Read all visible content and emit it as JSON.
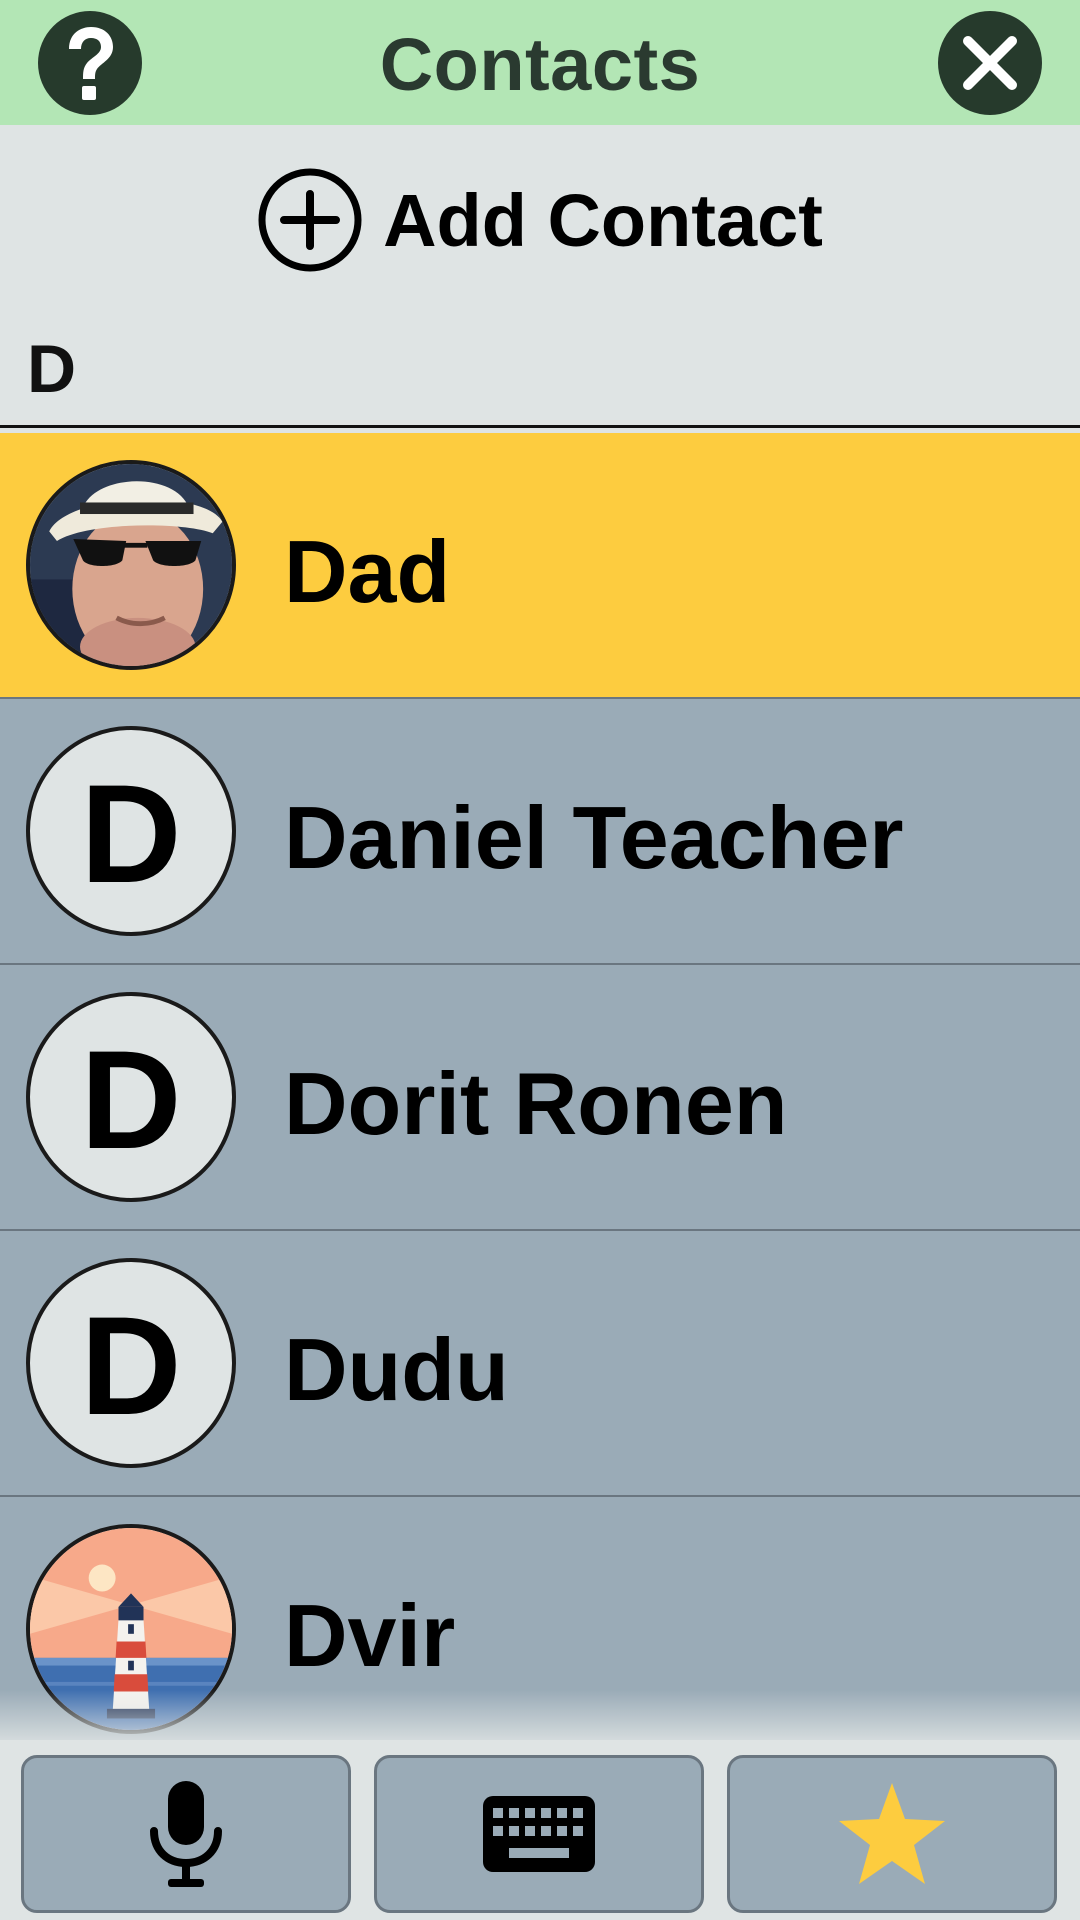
{
  "header": {
    "title": "Contacts",
    "help_icon": "help-question-icon",
    "close_icon": "close-x-icon",
    "color": "#b3e6b5"
  },
  "add_contact": {
    "label": "Add Contact",
    "icon": "plus-circle-icon"
  },
  "section": {
    "letter": "D"
  },
  "contacts": [
    {
      "name": "Dad",
      "avatar_type": "photo",
      "avatar_letter": "",
      "selected": true
    },
    {
      "name": "Daniel Teacher",
      "avatar_type": "letter",
      "avatar_letter": "D",
      "selected": false
    },
    {
      "name": "Dorit Ronen",
      "avatar_type": "letter",
      "avatar_letter": "D",
      "selected": false
    },
    {
      "name": "Dudu",
      "avatar_type": "letter",
      "avatar_letter": "D",
      "selected": false
    },
    {
      "name": "Dvir",
      "avatar_type": "illustration",
      "avatar_letter": "",
      "selected": false
    }
  ],
  "bottom_bar": {
    "buttons": [
      {
        "icon": "microphone-icon"
      },
      {
        "icon": "keyboard-icon"
      },
      {
        "icon": "star-icon"
      }
    ]
  },
  "colors": {
    "selected_row": "#fdcc3f",
    "row": "#9aabb7",
    "background": "#dfe4e4",
    "star": "#fdcc3f"
  }
}
